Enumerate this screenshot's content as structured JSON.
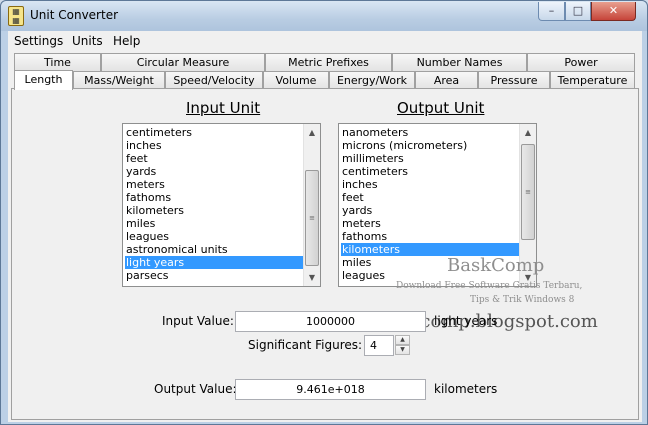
{
  "window": {
    "title": "Unit Converter",
    "icon_name": "app-calculator-icon",
    "min_glyph": "–",
    "max_glyph": "□",
    "close_glyph": "✕"
  },
  "menu": [
    "Settings",
    "Units",
    "Help"
  ],
  "tabs_row1": [
    "Time",
    "Circular Measure",
    "Metric Prefixes",
    "Number Names",
    "Power"
  ],
  "tabs_row2": [
    "Length",
    "Mass/Weight",
    "Speed/Velocity",
    "Volume",
    "Energy/Work",
    "Area",
    "Pressure",
    "Temperature"
  ],
  "active_tab": "Length",
  "input_unit": {
    "heading": "Input Unit",
    "items": [
      "centimeters",
      "inches",
      "feet",
      "yards",
      "meters",
      "fathoms",
      "kilometers",
      "miles",
      "leagues",
      "astronomical units",
      "light years",
      "parsecs"
    ],
    "selected": "light years"
  },
  "output_unit": {
    "heading": "Output Unit",
    "items": [
      "nanometers",
      "microns (micrometers)",
      "millimeters",
      "centimeters",
      "inches",
      "feet",
      "yards",
      "meters",
      "fathoms",
      "kilometers",
      "miles",
      "leagues"
    ],
    "selected": "kilometers"
  },
  "form": {
    "input_value_label": "Input Value:",
    "input_value": "1000000",
    "input_unit_name": "light years",
    "sig_figs_label": "Significant Figures:",
    "sig_figs": "4",
    "output_value_label": "Output Value:",
    "output_value": "9.461e+018",
    "output_unit_name": "kilometers"
  },
  "watermark": {
    "brand": "BaskComp",
    "tagline1": "Download Free Software Gratis Terbaru,",
    "tagline2": "Tips & Trik Windows 8",
    "url": "baskcomp.blogspot.com"
  },
  "colors": {
    "selection": "#3399ff",
    "title_gradient_top": "#d9e6f3",
    "close_button": "#c6443a"
  }
}
